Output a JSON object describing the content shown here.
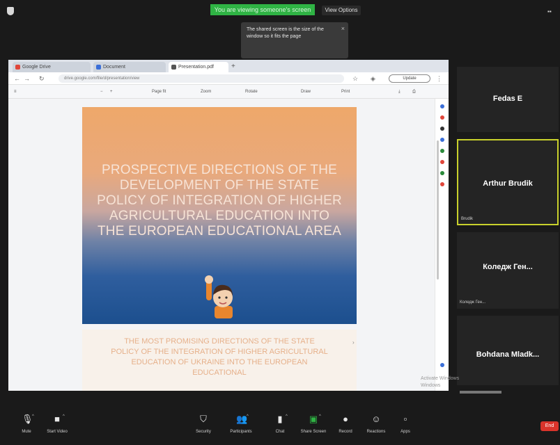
{
  "top": {
    "share_banner": "You are viewing someone's screen",
    "view_options": "View Options",
    "tooltip": "The shared screen is the size of the window so it fits the page"
  },
  "browser": {
    "tabs": [
      {
        "label": "Google Drive"
      },
      {
        "label": "Document"
      },
      {
        "label": "Presentation.pdf"
      }
    ],
    "url": "drive.google.com/file/d/presentation/view",
    "update_button": "Update",
    "toolbar": [
      "Page fit",
      "Zoom",
      "Rotate",
      "Draw",
      "Print"
    ]
  },
  "slides": {
    "slide1_title": "PROSPECTIVE DIRECTIONS OF THE DEVELOPMENT OF THE STATE POLICY OF INTEGRATION OF HIGHER AGRICULTURAL EDUCATION INTO THE EUROPEAN EDUCATIONAL AREA",
    "slide2_text": "THE MOST PROMISING DIRECTIONS OF THE STATE POLICY OF THE INTEGRATION OF HIGHER AGRICULTURAL EDUCATION OF UKRAINE INTO THE EUROPEAN EDUCATIONAL"
  },
  "participants": [
    {
      "name": "Fedas E",
      "label": ""
    },
    {
      "name": "Arthur Brudik",
      "label": "Brudik"
    },
    {
      "name": "Коледж Ген...",
      "label": "Коледж Ген..."
    },
    {
      "name": "Bohdana Mladk...",
      "label": ""
    }
  ],
  "watermark": {
    "line1": "Activate Windows",
    "line2": "Windows"
  },
  "controls": [
    {
      "label": "Mute",
      "icon": "microphone-icon"
    },
    {
      "label": "Start Video",
      "icon": "video-icon"
    },
    {
      "label": "Security",
      "icon": "shield-icon"
    },
    {
      "label": "Participants",
      "icon": "participants-icon"
    },
    {
      "label": "Chat",
      "icon": "chat-icon"
    },
    {
      "label": "Share Screen",
      "icon": "share-screen-icon"
    },
    {
      "label": "Record",
      "icon": "record-icon"
    },
    {
      "label": "Reactions",
      "icon": "reactions-icon"
    },
    {
      "label": "Apps",
      "icon": "apps-icon"
    }
  ],
  "end_button": "End",
  "colors": {
    "share_green": "#2fb344",
    "active_speaker_border": "#c9d12c",
    "end_red": "#d9342b"
  }
}
